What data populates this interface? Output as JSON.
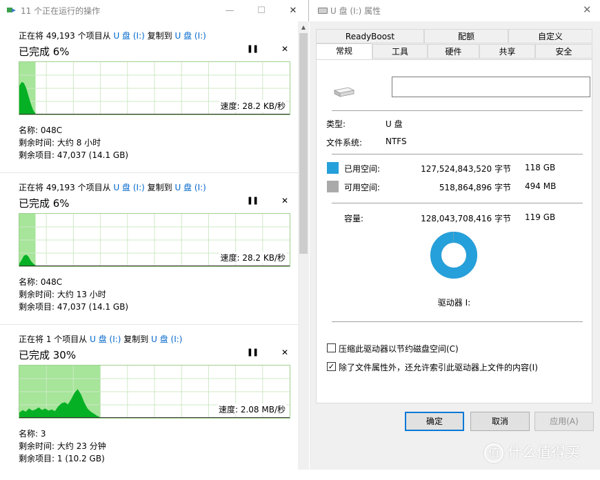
{
  "copy_window": {
    "title": "11 个正在运行的操作",
    "buttons": {
      "minimize": "—",
      "maximize": "☐",
      "close": "✕"
    },
    "labels": {
      "name": "名称:",
      "time_remaining": "剩余时间:",
      "items_remaining": "剩余项目:",
      "speed": "速度:"
    },
    "operations": [
      {
        "headline_prefix": "正在将 49,193 个项目从",
        "source": "U 盘 (I:)",
        "headline_mid": "复制到",
        "dest": "U 盘 (I:)",
        "percent_text": "已完成 6%",
        "progress": 0.06,
        "speed": "28.2 KB/秒",
        "name": "048C",
        "time_remaining": "大约 8 小时",
        "items_remaining": "47,037 (14.1 GB)",
        "graph": [
          0.55,
          0.62,
          0.6,
          0.5,
          0.35,
          0.2,
          0.08,
          0.02
        ]
      },
      {
        "headline_prefix": "正在将 49,193 个项目从",
        "source": "U 盘 (I:)",
        "headline_mid": "复制到",
        "dest": "U 盘 (I:)",
        "percent_text": "已完成 6%",
        "progress": 0.06,
        "speed": "28.2 KB/秒",
        "name": "048C",
        "time_remaining": "大约 13 小时",
        "items_remaining": "47,037 (14.1 GB)",
        "graph": [
          0.05,
          0.12,
          0.2,
          0.22,
          0.18,
          0.1,
          0.05,
          0.02
        ]
      },
      {
        "headline_prefix": "正在将 1 个项目从",
        "source": "U 盘 (I:)",
        "headline_mid": "复制到",
        "dest": "U 盘 (I:)",
        "percent_text": "已完成 30%",
        "progress": 0.3,
        "speed": "2.08 MB/秒",
        "name": "3",
        "time_remaining": "大约 23 分钟",
        "items_remaining": "1 (10.2 GB)",
        "graph": [
          0.1,
          0.15,
          0.12,
          0.18,
          0.14,
          0.16,
          0.2,
          0.15,
          0.18,
          0.14,
          0.16,
          0.13,
          0.22,
          0.28,
          0.3,
          0.26,
          0.36,
          0.48,
          0.55,
          0.45,
          0.3,
          0.18,
          0.12,
          0.08,
          0.04,
          0.01
        ]
      }
    ]
  },
  "properties_window": {
    "title": "U 盘 (I:) 属性",
    "close": "✕",
    "tabs_row1": [
      "ReadyBoost",
      "配额",
      "自定义"
    ],
    "tabs_row2": [
      "常规",
      "工具",
      "硬件",
      "共享",
      "安全"
    ],
    "active_tab": "常规",
    "drive_name_value": "",
    "type_label": "类型:",
    "type_value": "U 盘",
    "fs_label": "文件系统:",
    "fs_value": "NTFS",
    "used": {
      "label": "已用空间:",
      "bytes": "127,524,843,520 字节",
      "size": "118 GB",
      "color": "#26a0da"
    },
    "free": {
      "label": "可用空间:",
      "bytes": "518,864,896 字节",
      "size": "494 MB",
      "color": "#aaaaaa"
    },
    "capacity": {
      "label": "容量:",
      "bytes": "128,043,708,416 字节",
      "size": "119 GB"
    },
    "used_fraction": 0.996,
    "drive_label": "驱动器 I:",
    "compress_label": "压缩此驱动器以节约磁盘空间(C)",
    "compress_checked": false,
    "index_label": "除了文件属性外，还允许索引此驱动器上文件的内容(I)",
    "index_checked": true,
    "buttons": {
      "ok": "确定",
      "cancel": "取消",
      "apply": "应用(A)"
    }
  },
  "watermark": {
    "logo": "值",
    "text": "什么值得买"
  }
}
